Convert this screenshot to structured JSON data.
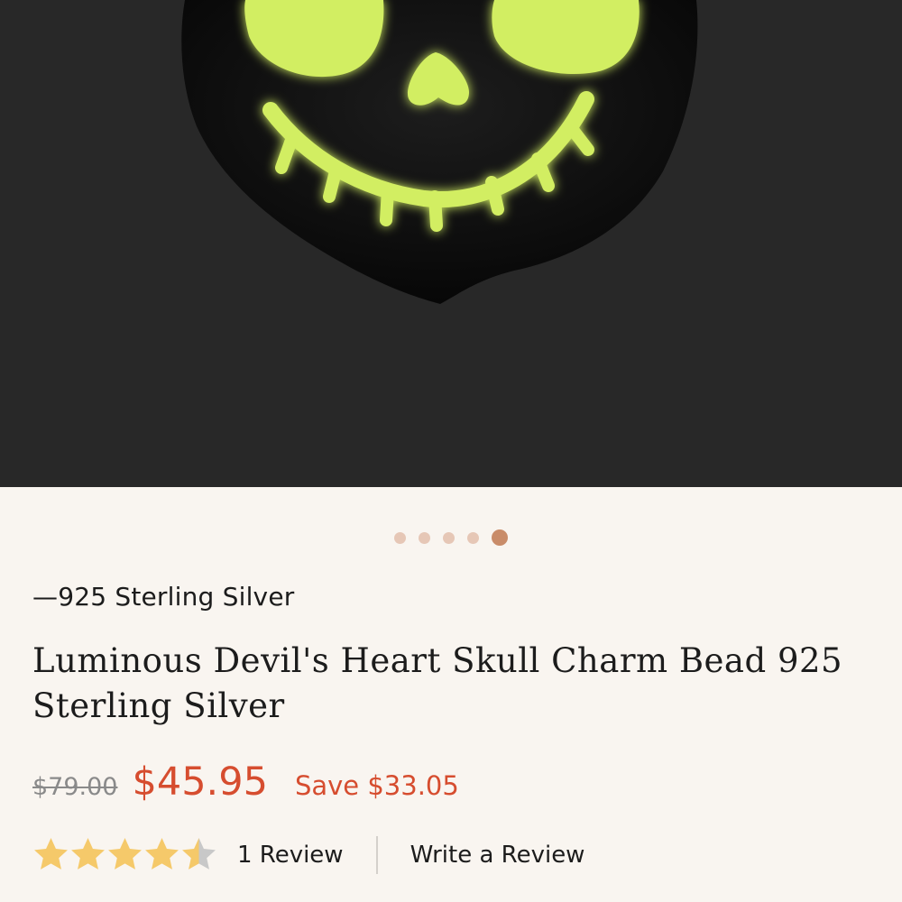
{
  "product": {
    "material_label": "—925 Sterling Silver",
    "title": "Luminous Devil's Heart Skull Charm Bead 925 Sterling Silver",
    "price": {
      "original": "$79.00",
      "current": "$45.95",
      "save": "Save $33.05"
    },
    "rating": {
      "value": 4.5,
      "max": 5,
      "review_count_label": "1 Review"
    },
    "write_review_label": "Write a Review"
  },
  "gallery": {
    "slide_count": 5,
    "active_index": 4
  },
  "colors": {
    "page_background": "#f9f5f0",
    "hero_background": "#282828",
    "sale_red": "#d64d2f",
    "star_gold": "#f5c96a",
    "star_grey": "#c8c8c8",
    "dot_inactive": "#e6c7b6",
    "dot_active": "#c98c69",
    "glow_green": "#d2ee62"
  }
}
